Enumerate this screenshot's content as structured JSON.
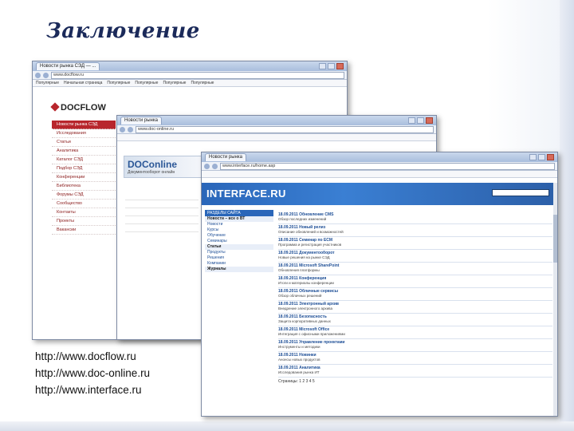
{
  "slide": {
    "title": "Заключение",
    "links": [
      "http://www.docflow.ru",
      "http://www.doc-online.ru",
      "http://www.interface.ru"
    ]
  },
  "windows": {
    "docflow": {
      "tab_title": "Новости рынка СЭД — ...",
      "url": "www.docflow.ru",
      "bookmarks": [
        "Популярные",
        "Начальная страница",
        "Популярные",
        "Популярные",
        "Популярные",
        "Популярные"
      ],
      "logo_text": "DOCFLOW",
      "menu": [
        "Новости рынка СЭД",
        "Исследования",
        "Статьи",
        "Аналитика",
        "Каталог СЭД",
        "Подбор СЭД",
        "Конференции",
        "Библиотека",
        "Форумы СЭД",
        "Сообщество",
        "Контакты",
        "Проекты",
        "Вакансии"
      ]
    },
    "doconline": {
      "tab_title": "Новости рынка",
      "url": "www.doc-online.ru",
      "banner_title": "DOConline",
      "banner_sub": "Документооборот онлайн"
    },
    "interface": {
      "tab_title": "Новости рынка",
      "url": "www.interface.ru/home.asp",
      "logo": "INTERFACE.RU",
      "nav_header": "РАЗДЕЛЫ САЙТА",
      "nav_items": [
        "Новости – все о ВТ",
        "Новости",
        "Курсы",
        "Обучение",
        "Семинары",
        "Статьи",
        "Продукты",
        "Решения",
        "Компании",
        "Журналы"
      ],
      "news_items": [
        {
          "title": "18.09.2011 Обновление CMS",
          "desc": "Обзор последних изменений"
        },
        {
          "title": "18.09.2011 Новый релиз",
          "desc": "Описание обновлений и возможностей"
        },
        {
          "title": "18.09.2011 Семинар по ECM",
          "desc": "Программа и регистрация участников"
        },
        {
          "title": "18.09.2011 Документооборот",
          "desc": "Новые решения на рынке СЭД"
        },
        {
          "title": "18.09.2011 Microsoft SharePoint",
          "desc": "Обновления платформы"
        },
        {
          "title": "18.09.2011 Конференция",
          "desc": "Итоги и материалы конференции"
        },
        {
          "title": "18.09.2011 Облачные сервисы",
          "desc": "Обзор облачных решений"
        },
        {
          "title": "18.09.2011 Электронный архив",
          "desc": "Внедрение электронного архива"
        },
        {
          "title": "18.09.2011 Безопасность",
          "desc": "Защита корпоративных данных"
        },
        {
          "title": "18.09.2011 Microsoft Office",
          "desc": "Интеграция с офисными приложениями"
        },
        {
          "title": "18.09.2011 Управление проектами",
          "desc": "Инструменты и методики"
        },
        {
          "title": "18.09.2011 Новинки",
          "desc": "Анонсы новых продуктов"
        },
        {
          "title": "18.09.2011 Аналитика",
          "desc": "Исследования рынка ИТ"
        }
      ],
      "pager": "Страницы: 1 2 3 4 5"
    }
  }
}
